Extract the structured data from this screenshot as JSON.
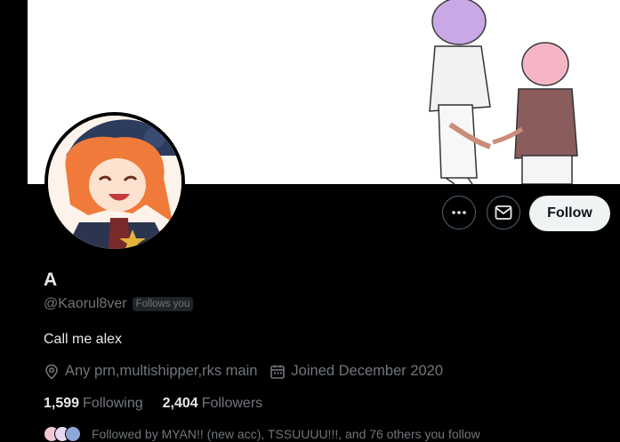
{
  "profile": {
    "display_name": "A",
    "handle": "@Kaorul8ver",
    "follows_you_badge": "Follows you",
    "bio": "Call me alex",
    "location": "Any prn,multishipper,rks main",
    "joined": "Joined December 2020"
  },
  "stats": {
    "following_count": "1,599",
    "following_label": "Following",
    "followers_count": "2,404",
    "followers_label": "Followers"
  },
  "actions": {
    "follow_label": "Follow"
  },
  "followed_by": {
    "text": "Followed by MYAN!! (new acc), TSSUUUU!!!, and 76 others you follow"
  },
  "icons": {
    "more": "more-horizontal-icon",
    "message": "envelope-icon",
    "location": "location-pin-icon",
    "calendar": "calendar-icon"
  },
  "colors": {
    "background": "#000000",
    "primary_text": "#e7e9ea",
    "secondary_text": "#71767b",
    "follow_button_bg": "#eff3f4",
    "border": "#536471"
  }
}
